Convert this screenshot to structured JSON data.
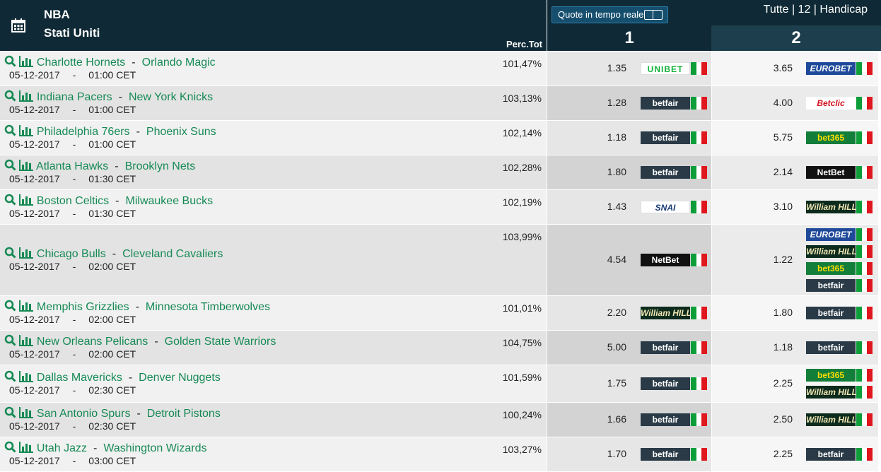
{
  "header": {
    "league": "NBA",
    "country": "Stati Uniti",
    "perc_label": "Perc.Tot",
    "realtime_label": "Quote in tempo reale",
    "filters": "Tutte | 12 | Handicap",
    "col1": "1",
    "col2": "2"
  },
  "icons": {
    "calendar": "calendar-icon",
    "search": "search-icon",
    "stats": "stats-icon"
  },
  "colors": {
    "header_bg": "#0f2a36",
    "team_link": "#168a55",
    "accent": "#2c7fae"
  },
  "matches": [
    {
      "home": "Charlotte Hornets",
      "away": "Orlando Magic",
      "date": "05-12-2017",
      "dash": "-",
      "time": "01:00 CET",
      "perc": "101,47%",
      "odd1": "1.35",
      "odd2": "3.65",
      "b1": [
        {
          "name": "unibet",
          "logo": "UNIBET"
        }
      ],
      "b2": [
        {
          "name": "eurobet",
          "logo": "EUROBET"
        }
      ]
    },
    {
      "home": "Indiana Pacers",
      "away": "New York Knicks",
      "date": "05-12-2017",
      "dash": "-",
      "time": "01:00 CET",
      "perc": "103,13%",
      "odd1": "1.28",
      "odd2": "4.00",
      "b1": [
        {
          "name": "betfair",
          "logo": "betfair"
        }
      ],
      "b2": [
        {
          "name": "betclic",
          "logo": "Betclic"
        }
      ]
    },
    {
      "home": "Philadelphia 76ers",
      "away": "Phoenix Suns",
      "date": "05-12-2017",
      "dash": "-",
      "time": "01:00 CET",
      "perc": "102,14%",
      "odd1": "1.18",
      "odd2": "5.75",
      "b1": [
        {
          "name": "betfair",
          "logo": "betfair"
        }
      ],
      "b2": [
        {
          "name": "bet365",
          "logo": "bet365"
        }
      ]
    },
    {
      "home": "Atlanta Hawks",
      "away": "Brooklyn Nets",
      "date": "05-12-2017",
      "dash": "-",
      "time": "01:30 CET",
      "perc": "102,28%",
      "odd1": "1.80",
      "odd2": "2.14",
      "b1": [
        {
          "name": "betfair",
          "logo": "betfair"
        }
      ],
      "b2": [
        {
          "name": "netbet",
          "logo": "NetBet"
        }
      ]
    },
    {
      "home": "Boston Celtics",
      "away": "Milwaukee Bucks",
      "date": "05-12-2017",
      "dash": "-",
      "time": "01:30 CET",
      "perc": "102,19%",
      "odd1": "1.43",
      "odd2": "3.10",
      "b1": [
        {
          "name": "snai",
          "logo": "SNAI"
        }
      ],
      "b2": [
        {
          "name": "williamhill",
          "logo": "William HILL"
        }
      ]
    },
    {
      "home": "Chicago Bulls",
      "away": "Cleveland Cavaliers",
      "date": "05-12-2017",
      "dash": "-",
      "time": "02:00 CET",
      "perc": "103,99%",
      "odd1": "4.54",
      "odd2": "1.22",
      "b1": [
        {
          "name": "netbet",
          "logo": "NetBet"
        }
      ],
      "b2": [
        {
          "name": "eurobet",
          "logo": "EUROBET"
        },
        {
          "name": "williamhill",
          "logo": "William HILL"
        },
        {
          "name": "bet365",
          "logo": "bet365"
        },
        {
          "name": "betfair",
          "logo": "betfair"
        }
      ]
    },
    {
      "home": "Memphis Grizzlies",
      "away": "Minnesota Timberwolves",
      "date": "05-12-2017",
      "dash": "-",
      "time": "02:00 CET",
      "perc": "101,01%",
      "odd1": "2.20",
      "odd2": "1.80",
      "b1": [
        {
          "name": "williamhill",
          "logo": "William HILL"
        }
      ],
      "b2": [
        {
          "name": "betfair",
          "logo": "betfair"
        }
      ]
    },
    {
      "home": "New Orleans Pelicans",
      "away": "Golden State Warriors",
      "date": "05-12-2017",
      "dash": "-",
      "time": "02:00 CET",
      "perc": "104,75%",
      "odd1": "5.00",
      "odd2": "1.18",
      "b1": [
        {
          "name": "betfair",
          "logo": "betfair"
        }
      ],
      "b2": [
        {
          "name": "betfair",
          "logo": "betfair"
        }
      ]
    },
    {
      "home": "Dallas Mavericks",
      "away": "Denver Nuggets",
      "date": "05-12-2017",
      "dash": "-",
      "time": "02:30 CET",
      "perc": "101,59%",
      "odd1": "1.75",
      "odd2": "2.25",
      "b1": [
        {
          "name": "betfair",
          "logo": "betfair"
        }
      ],
      "b2": [
        {
          "name": "bet365",
          "logo": "bet365"
        },
        {
          "name": "williamhill",
          "logo": "William HILL"
        }
      ]
    },
    {
      "home": "San Antonio Spurs",
      "away": "Detroit Pistons",
      "date": "05-12-2017",
      "dash": "-",
      "time": "02:30 CET",
      "perc": "100,24%",
      "odd1": "1.66",
      "odd2": "2.50",
      "b1": [
        {
          "name": "betfair",
          "logo": "betfair"
        }
      ],
      "b2": [
        {
          "name": "williamhill",
          "logo": "William HILL"
        }
      ]
    },
    {
      "home": "Utah Jazz",
      "away": "Washington Wizards",
      "date": "05-12-2017",
      "dash": "-",
      "time": "03:00 CET",
      "perc": "103,27%",
      "odd1": "1.70",
      "odd2": "2.25",
      "b1": [
        {
          "name": "betfair",
          "logo": "betfair"
        }
      ],
      "b2": [
        {
          "name": "betfair",
          "logo": "betfair"
        }
      ]
    }
  ]
}
